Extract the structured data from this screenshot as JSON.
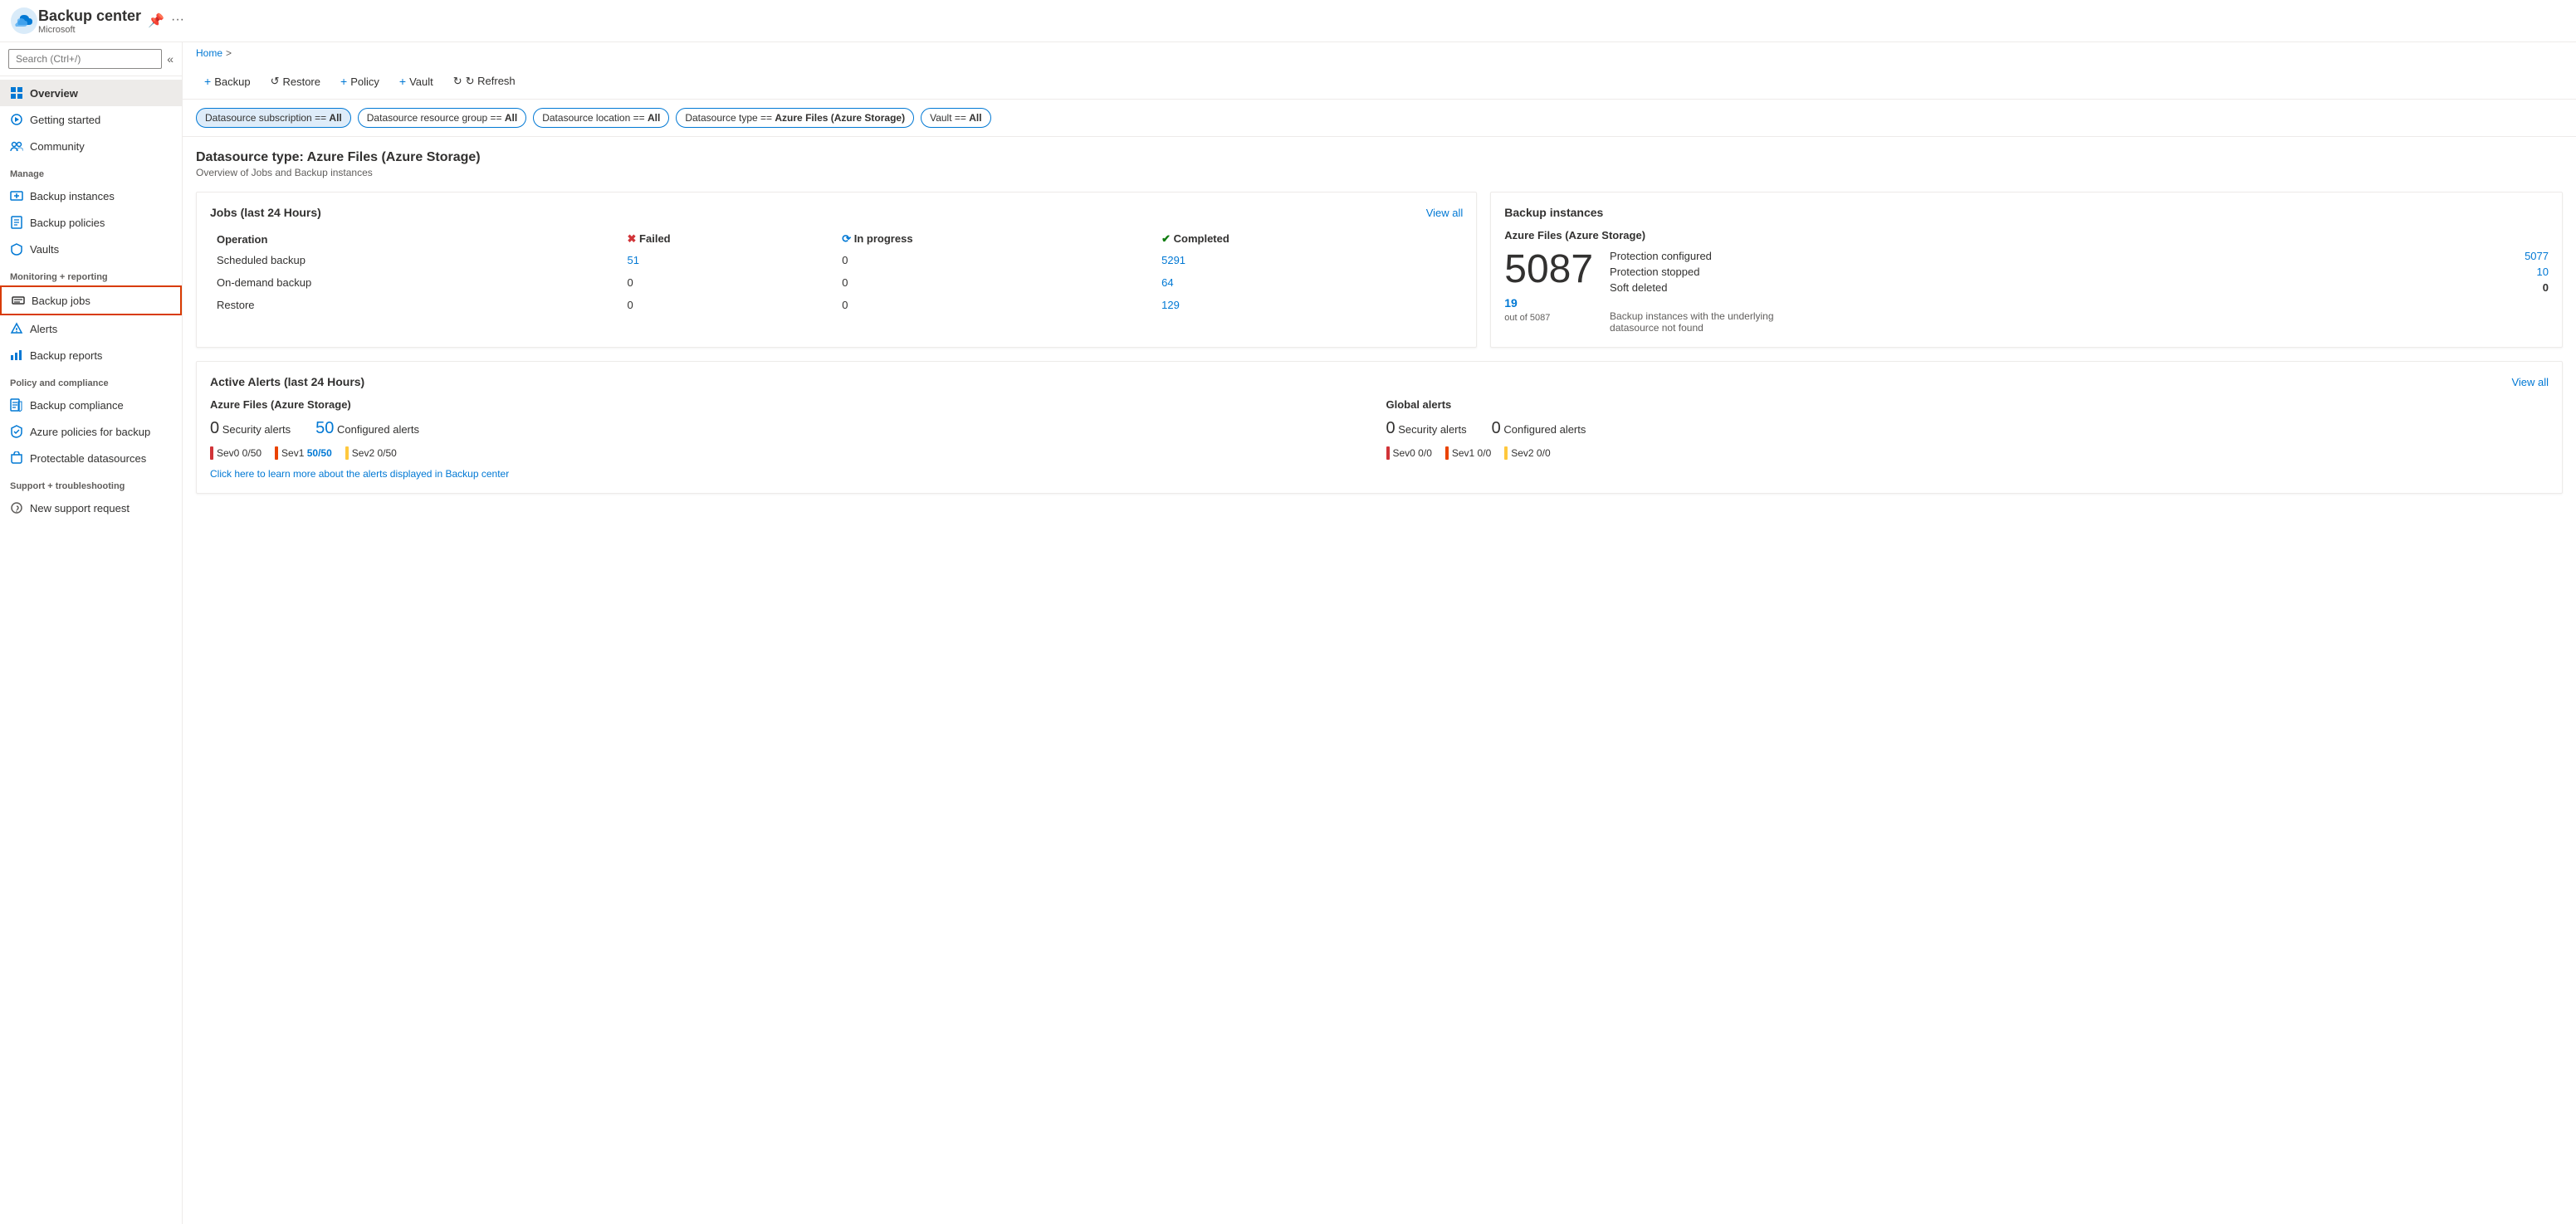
{
  "app": {
    "title": "Backup center",
    "subtitle": "Microsoft",
    "pin_icon": "📌",
    "more_icon": "···"
  },
  "breadcrumb": {
    "home": "Home",
    "separator": ">"
  },
  "search": {
    "placeholder": "Search (Ctrl+/)"
  },
  "toolbar": {
    "backup_label": "+ Backup",
    "restore_label": "↺ Restore",
    "policy_label": "+ Policy",
    "vault_label": "+ Vault",
    "refresh_label": "↻ Refresh"
  },
  "filters": [
    {
      "label": "Datasource subscription == All",
      "active": true
    },
    {
      "label": "Datasource resource group == All",
      "active": false
    },
    {
      "label": "Datasource location == All",
      "active": false
    },
    {
      "label": "Datasource type == Azure Files (Azure Storage)",
      "active": false
    },
    {
      "label": "Vault == All",
      "active": false
    }
  ],
  "page": {
    "title": "Datasource type: Azure Files (Azure Storage)",
    "subtitle": "Overview of Jobs and Backup instances"
  },
  "jobs_card": {
    "title": "Jobs (last 24 Hours)",
    "view_all": "View all",
    "col_operation": "Operation",
    "col_failed": "Failed",
    "col_inprogress": "In progress",
    "col_completed": "Completed",
    "rows": [
      {
        "operation": "Scheduled backup",
        "failed": "51",
        "inprogress": "0",
        "completed": "5291"
      },
      {
        "operation": "On-demand backup",
        "failed": "0",
        "inprogress": "0",
        "completed": "64"
      },
      {
        "operation": "Restore",
        "failed": "0",
        "inprogress": "0",
        "completed": "129"
      }
    ]
  },
  "backup_instances_card": {
    "title": "Backup instances",
    "subtitle": "Azure Files (Azure Storage)",
    "big_number": "5087",
    "protection_configured_label": "Protection configured",
    "protection_configured_value": "5077",
    "protection_stopped_label": "Protection stopped",
    "protection_stopped_value": "10",
    "soft_deleted_label": "Soft deleted",
    "soft_deleted_value": "0",
    "not_found_num": "19",
    "not_found_of": "out of 5087",
    "not_found_text": "Backup instances with the underlying datasource not found"
  },
  "alerts_card": {
    "title": "Active Alerts (last 24 Hours)",
    "view_all": "View all",
    "azure_section": {
      "title": "Azure Files (Azure Storage)",
      "security_count": "0",
      "security_label": "Security alerts",
      "configured_count": "50",
      "configured_label": "Configured alerts",
      "sev0": "Sev0  0/50",
      "sev1": "Sev1",
      "sev1_value": "50/50",
      "sev2": "Sev2  0/50"
    },
    "global_section": {
      "title": "Global alerts",
      "security_count": "0",
      "security_label": "Security alerts",
      "configured_count": "0",
      "configured_label": "Configured alerts",
      "sev0": "Sev0  0/0",
      "sev1": "Sev1  0/0",
      "sev2": "Sev2  0/0"
    },
    "learn_more_link": "Click here to learn more about the alerts displayed in Backup center"
  },
  "sidebar": {
    "nav_items": [
      {
        "id": "overview",
        "label": "Overview",
        "icon": "overview",
        "section": null,
        "active": true
      },
      {
        "id": "getting-started",
        "label": "Getting started",
        "icon": "start",
        "section": null
      },
      {
        "id": "community",
        "label": "Community",
        "icon": "community",
        "section": null
      },
      {
        "id": "manage-section",
        "label": "Manage",
        "section_header": true
      },
      {
        "id": "backup-instances",
        "label": "Backup instances",
        "icon": "instances",
        "section": "manage"
      },
      {
        "id": "backup-policies",
        "label": "Backup policies",
        "icon": "policies",
        "section": "manage"
      },
      {
        "id": "vaults",
        "label": "Vaults",
        "icon": "vaults",
        "section": "manage"
      },
      {
        "id": "monitoring-section",
        "label": "Monitoring + reporting",
        "section_header": true
      },
      {
        "id": "backup-jobs",
        "label": "Backup jobs",
        "icon": "jobs",
        "section": "monitoring",
        "highlight": true
      },
      {
        "id": "alerts",
        "label": "Alerts",
        "icon": "alerts",
        "section": "monitoring"
      },
      {
        "id": "backup-reports",
        "label": "Backup reports",
        "icon": "reports",
        "section": "monitoring"
      },
      {
        "id": "policy-section",
        "label": "Policy and compliance",
        "section_header": true
      },
      {
        "id": "backup-compliance",
        "label": "Backup compliance",
        "icon": "compliance",
        "section": "policy"
      },
      {
        "id": "azure-policies",
        "label": "Azure policies for backup",
        "icon": "azpolicies",
        "section": "policy"
      },
      {
        "id": "protectable",
        "label": "Protectable datasources",
        "icon": "protectable",
        "section": "policy"
      },
      {
        "id": "support-section",
        "label": "Support + troubleshooting",
        "section_header": true
      },
      {
        "id": "new-support",
        "label": "New support request",
        "icon": "support",
        "section": "support"
      }
    ]
  }
}
